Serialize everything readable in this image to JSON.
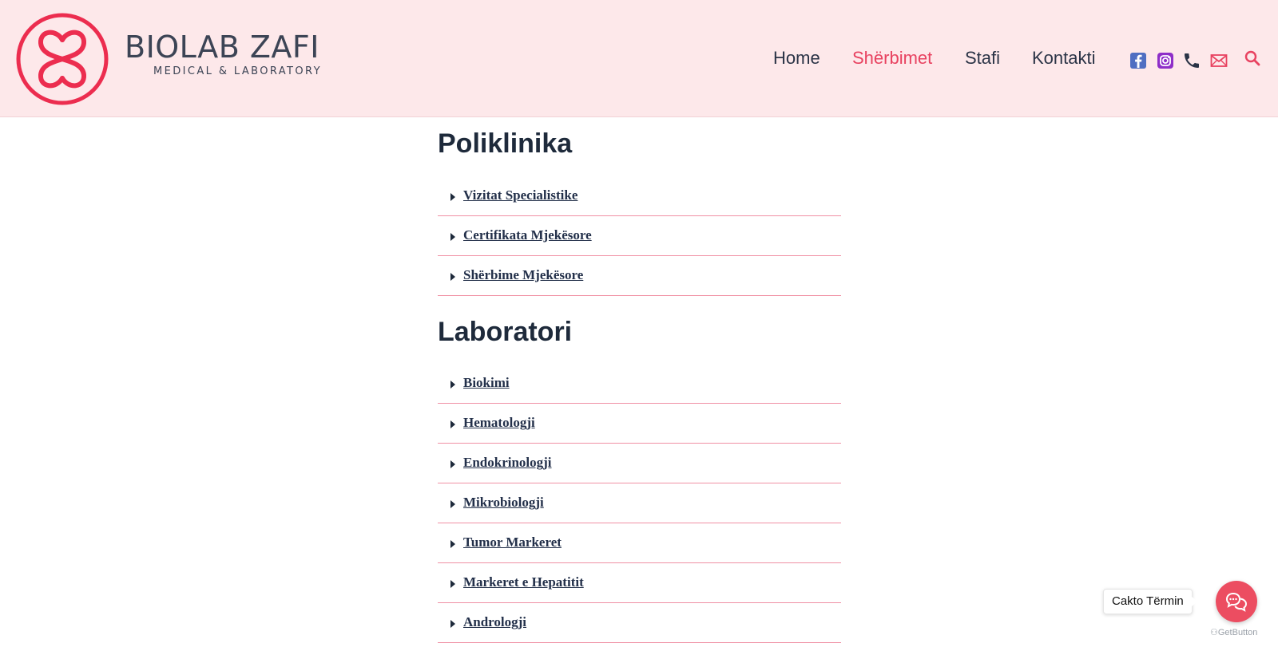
{
  "brand": {
    "name": "BIOLAB ZAFI",
    "tagline": "MEDICAL & LABORATORY",
    "logo_icon": "double-heart-logo"
  },
  "nav": {
    "items": [
      {
        "label": "Home",
        "active": false
      },
      {
        "label": "Shërbimet",
        "active": true
      },
      {
        "label": "Stafi",
        "active": false
      },
      {
        "label": "Kontakti",
        "active": false
      }
    ]
  },
  "header_icons": [
    "facebook-icon",
    "instagram-icon",
    "phone-icon",
    "mail-icon",
    "search-icon"
  ],
  "sections": [
    {
      "title": "Poliklinika",
      "items": [
        "Vizitat Specialistike",
        "Certifikata Mjekësore",
        "Shërbime Mjekësore"
      ]
    },
    {
      "title": "Laboratori",
      "items": [
        "Biokimi",
        "Hematologji",
        "Endokrinologji",
        "Mikrobiologji",
        "Tumor Markeret",
        "Markeret e Hepatitit",
        "Andrologji"
      ]
    }
  ],
  "chat": {
    "bubble_text": "Cakto Tërmin",
    "powered_by": "GetButton"
  },
  "colors": {
    "accent": "#e84260",
    "header_bg": "#fde8ea",
    "divider": "#f090a4",
    "text_dark": "#1e2a3b"
  }
}
